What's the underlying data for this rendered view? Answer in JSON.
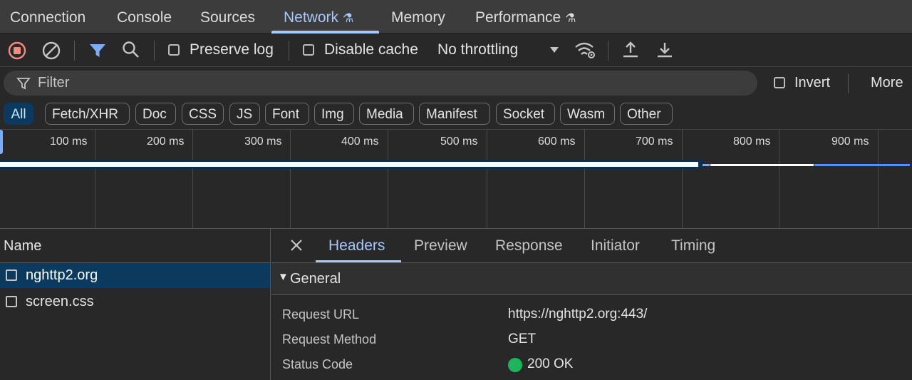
{
  "tabs": [
    {
      "label": "Connection",
      "experimental": false
    },
    {
      "label": "Console",
      "experimental": false
    },
    {
      "label": "Sources",
      "experimental": false
    },
    {
      "label": "Network",
      "experimental": true,
      "active": true
    },
    {
      "label": "Memory",
      "experimental": false
    },
    {
      "label": "Performance",
      "experimental": true
    }
  ],
  "toolbar": {
    "preserve_log": "Preserve log",
    "disable_cache": "Disable cache",
    "throttling": "No throttling",
    "icons": [
      "record-stop-icon",
      "clear-icon",
      "filter-icon",
      "search-icon",
      "network-conditions-icon",
      "import-har-icon",
      "export-har-icon"
    ]
  },
  "filter": {
    "placeholder": "Filter",
    "invert": "Invert",
    "more": "More"
  },
  "chips": [
    "All",
    "Fetch/XHR",
    "Doc",
    "CSS",
    "JS",
    "Font",
    "Img",
    "Media",
    "Manifest",
    "Socket",
    "Wasm",
    "Other"
  ],
  "timeline": {
    "ticks": [
      "100 ms",
      "200 ms",
      "300 ms",
      "400 ms",
      "500 ms",
      "600 ms",
      "700 ms",
      "800 ms",
      "900 ms"
    ]
  },
  "requests": {
    "header": "Name",
    "items": [
      "nghttp2.org",
      "screen.css"
    ]
  },
  "detail": {
    "tabs": [
      "Headers",
      "Preview",
      "Response",
      "Initiator",
      "Timing"
    ],
    "section": "General",
    "fields": [
      {
        "key": "Request URL",
        "value": "https://nghttp2.org:443/"
      },
      {
        "key": "Request Method",
        "value": "GET"
      },
      {
        "key": "Status Code",
        "value": "200 OK"
      }
    ]
  },
  "colors": {
    "accent": "#a8c7fa",
    "record": "#f28b82",
    "status_ok": "#1bb55c",
    "selected_row": "#0c3a5e"
  }
}
